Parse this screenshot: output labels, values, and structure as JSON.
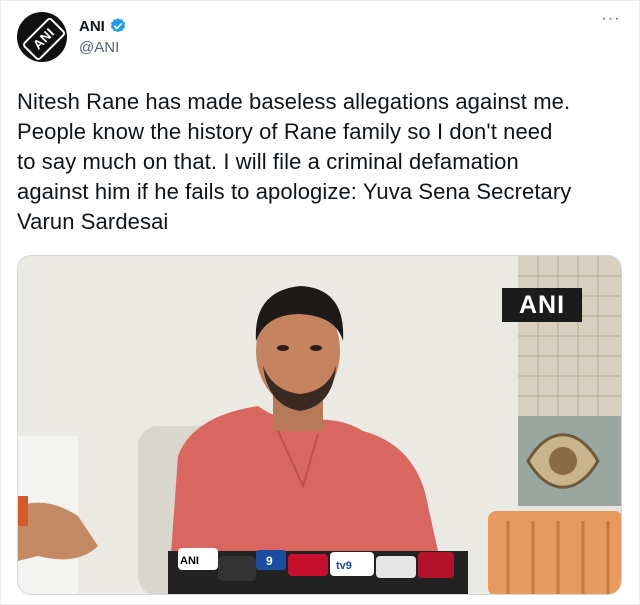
{
  "author": {
    "name": "ANI",
    "handle": "@ANI",
    "avatar_text": "ANI",
    "verified": true,
    "verified_color": "#1d9bf0"
  },
  "more_label": "···",
  "tweet": {
    "text": "Nitesh Rane has made baseless allegations against me.\nPeople know the history of Rane family so I don't need\nto say much on that. I will file a criminal defamation\nagainst him if he fails to apologize: Yuva Sena Secretary\nVarun Sardesai"
  },
  "media": {
    "watermark": "ANI",
    "mic_labels": [
      "ANI",
      "9",
      "tv9"
    ]
  },
  "colors": {
    "text": "#0f1419",
    "secondary": "#536471",
    "border": "#cfd9de",
    "shirt": "#d9665f",
    "chair": "#e89a5e"
  }
}
